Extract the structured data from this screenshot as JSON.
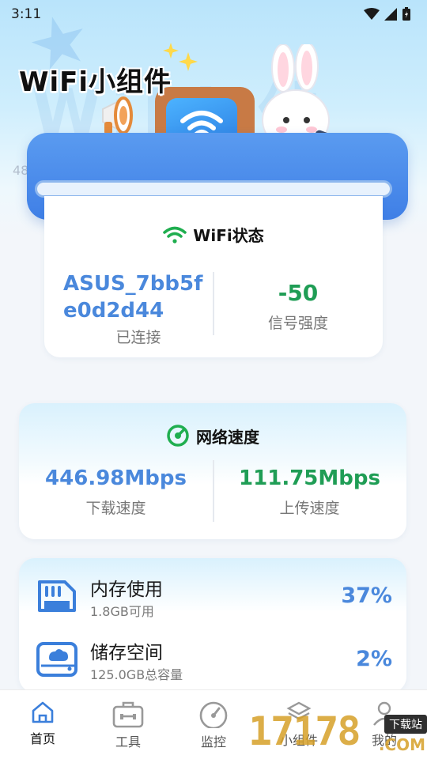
{
  "status_bar": {
    "time": "3:11"
  },
  "hero": {
    "title": "WiFi小组件",
    "watermark": "4835af"
  },
  "wifi_card": {
    "title": "WiFi状态",
    "ssid": "ASUS_7bb5fe0d2d44",
    "connection_status": "已连接",
    "signal_value": "-50",
    "signal_label": "信号强度",
    "colors": {
      "ssid": "#4a88dc",
      "signal": "#1f9d55",
      "wifi_icon": "#1fae4f"
    }
  },
  "speed_card": {
    "title": "网络速度",
    "download_value": "446.98Mbps",
    "download_label": "下载速度",
    "upload_value": "111.75Mbps",
    "upload_label": "上传速度",
    "colors": {
      "download": "#4a88dc",
      "upload": "#1f9d55"
    }
  },
  "storage_card": {
    "memory": {
      "label": "内存使用",
      "detail": "1.8GB可用",
      "percent": "37%"
    },
    "storage": {
      "label": "储存空间",
      "detail": "125.0GB总容量",
      "percent": "2%"
    }
  },
  "tab_bar": {
    "items": [
      {
        "label": "首页",
        "icon": "home-icon",
        "active": true
      },
      {
        "label": "工具",
        "icon": "toolbox-icon",
        "active": false
      },
      {
        "label": "监控",
        "icon": "gauge-icon",
        "active": false
      },
      {
        "label": "小组件",
        "icon": "layers-icon",
        "active": false
      },
      {
        "label": "我的",
        "icon": "user-icon",
        "active": false
      }
    ]
  },
  "site_watermark": {
    "text": "17178",
    "tag": "下载站",
    "suffix": ".COM"
  }
}
